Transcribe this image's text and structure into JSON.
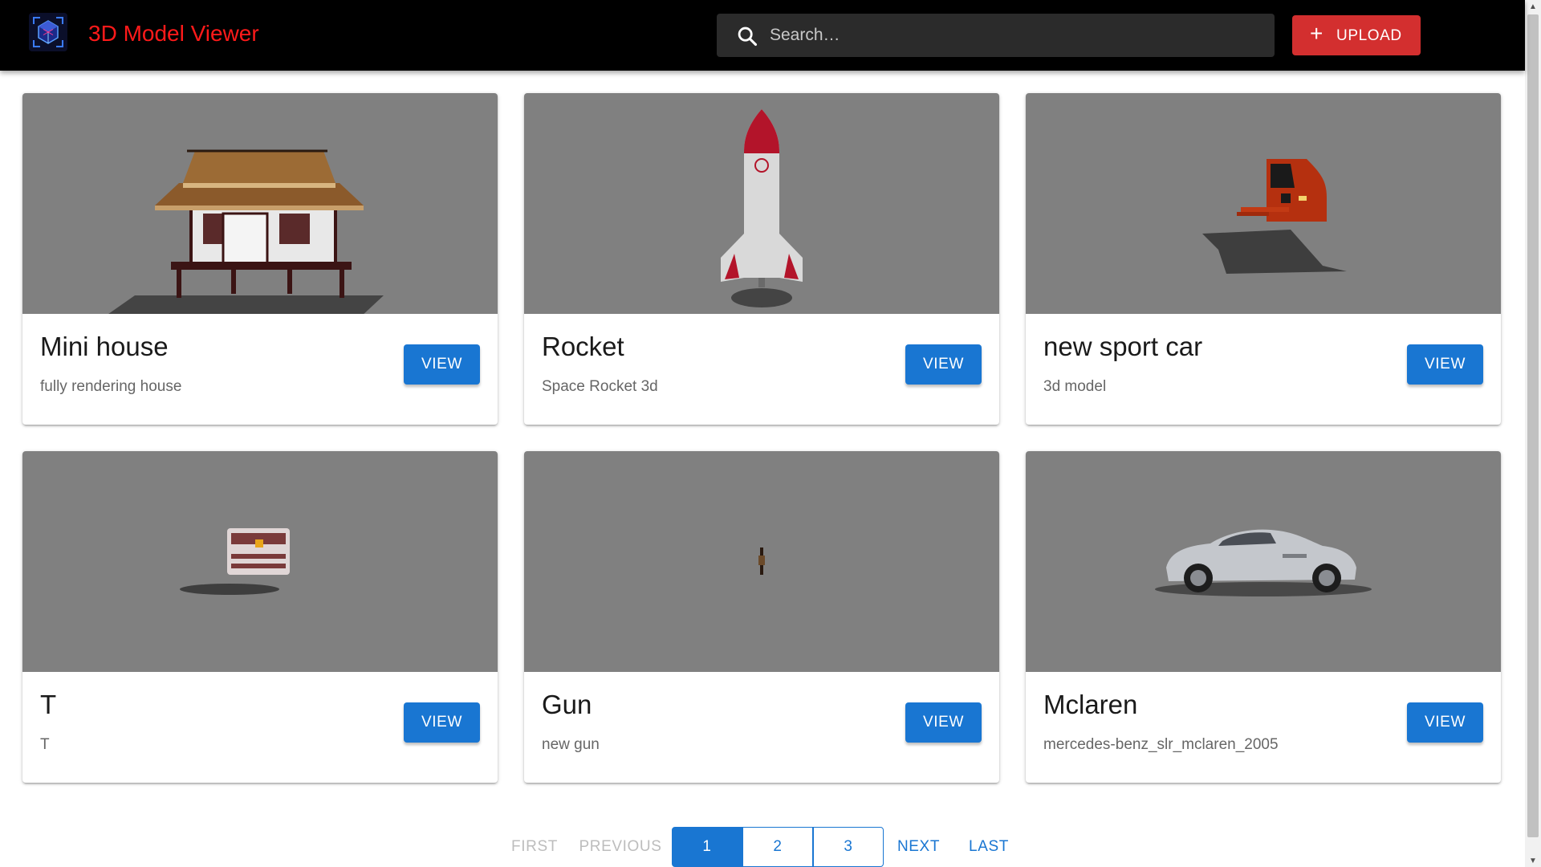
{
  "header": {
    "title": "3D Model Viewer",
    "search_placeholder": "Search…",
    "upload_label": "UPLOAD",
    "upload_icon": "plus-icon",
    "logo_icon": "cube-logo-icon",
    "colors": {
      "bar": "#000000",
      "title": "#ff1a1a",
      "upload": "#d32f2f"
    }
  },
  "cards": [
    {
      "title": "Mini house",
      "description": "fully rendering house",
      "button": "VIEW",
      "thumbnail": "house-model"
    },
    {
      "title": "Rocket",
      "description": "Space Rocket 3d",
      "button": "VIEW",
      "thumbnail": "rocket-model"
    },
    {
      "title": "new sport car",
      "description": "3d model",
      "button": "VIEW",
      "thumbnail": "sport-car-model"
    },
    {
      "title": "T",
      "description": "T",
      "button": "VIEW",
      "thumbnail": "chest-model"
    },
    {
      "title": "Gun",
      "description": "new gun",
      "button": "VIEW",
      "thumbnail": "gun-model"
    },
    {
      "title": "Mclaren",
      "description": "mercedes-benz_slr_mclaren_2005",
      "button": "VIEW",
      "thumbnail": "mclaren-model"
    }
  ],
  "pagination": {
    "first": "FIRST",
    "previous": "PREVIOUS",
    "pages": [
      "1",
      "2",
      "3"
    ],
    "current": "1",
    "next": "NEXT",
    "last": "LAST"
  },
  "theme": {
    "primary": "#1976d2",
    "media_bg": "#808080"
  }
}
